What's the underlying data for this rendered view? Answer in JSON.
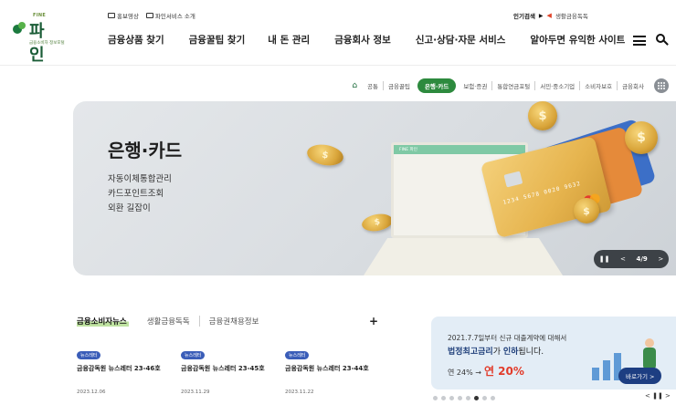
{
  "brand": {
    "name": "파 인",
    "small_label": "FINE",
    "tagline": "금융소비자 정보포털",
    "accent": "#2d8a3e"
  },
  "util_links": [
    "홍보영상",
    "파인서비스 소개"
  ],
  "hot_keywords": {
    "label": "인기검색",
    "keyword": "생활금융독독"
  },
  "gnb": [
    "금융상품 찾기",
    "금융꿀팁 찾기",
    "내 돈 관리",
    "금융회사 정보",
    "신고·상담·자문 서비스",
    "알아두면 유익한 사이트"
  ],
  "categories": {
    "items": [
      "공통",
      "금융꿀팁",
      "은행·카드",
      "보험·증권",
      "통합연금포털",
      "서민·중소기업",
      "소비자보호",
      "금융회사"
    ],
    "active": "은행·카드"
  },
  "hero": {
    "title": "은행·카드",
    "links": [
      "자동이체통합관리",
      "카드포인트조회",
      "외환 길잡이"
    ],
    "screen_label": "FINE 파인",
    "card_number": "1234 5678 0020 9632",
    "pager": {
      "current": "4",
      "total": "9",
      "text": "4/9"
    }
  },
  "news": {
    "tabs": [
      "금융소비자뉴스",
      "생활금융독독",
      "금융권채용정보"
    ],
    "active_tab": "금융소비자뉴스",
    "more": "+",
    "items": [
      {
        "badge": "뉴스레터",
        "title": "금융감독원 뉴스레터 23-46호",
        "date": "2023.12.06"
      },
      {
        "badge": "뉴스레터",
        "title": "금융감독원 뉴스레터 23-45호",
        "date": "2023.11.29"
      },
      {
        "badge": "뉴스레터",
        "title": "금융감독원 뉴스레터 23-44호",
        "date": "2023.11.22"
      }
    ]
  },
  "promo": {
    "line1": "2021.7.7일부터 신규 대출계약에 대해서",
    "line2_bold_a": "법정최고금리",
    "line2_mid": "가 ",
    "line2_bold_b": "인하",
    "line2_tail": "됩니다.",
    "from": "연 24% →",
    "to": "연 20%",
    "button": "바로가기 >",
    "dots_total": 8,
    "dots_active": 6,
    "controls": "< ❚❚ >"
  },
  "colors": {
    "active_tab_bg": "#2d8a3e",
    "badge": "#3a5db8",
    "promo_highlight": "#e23c2b",
    "pager_bg": "#3d4247"
  }
}
